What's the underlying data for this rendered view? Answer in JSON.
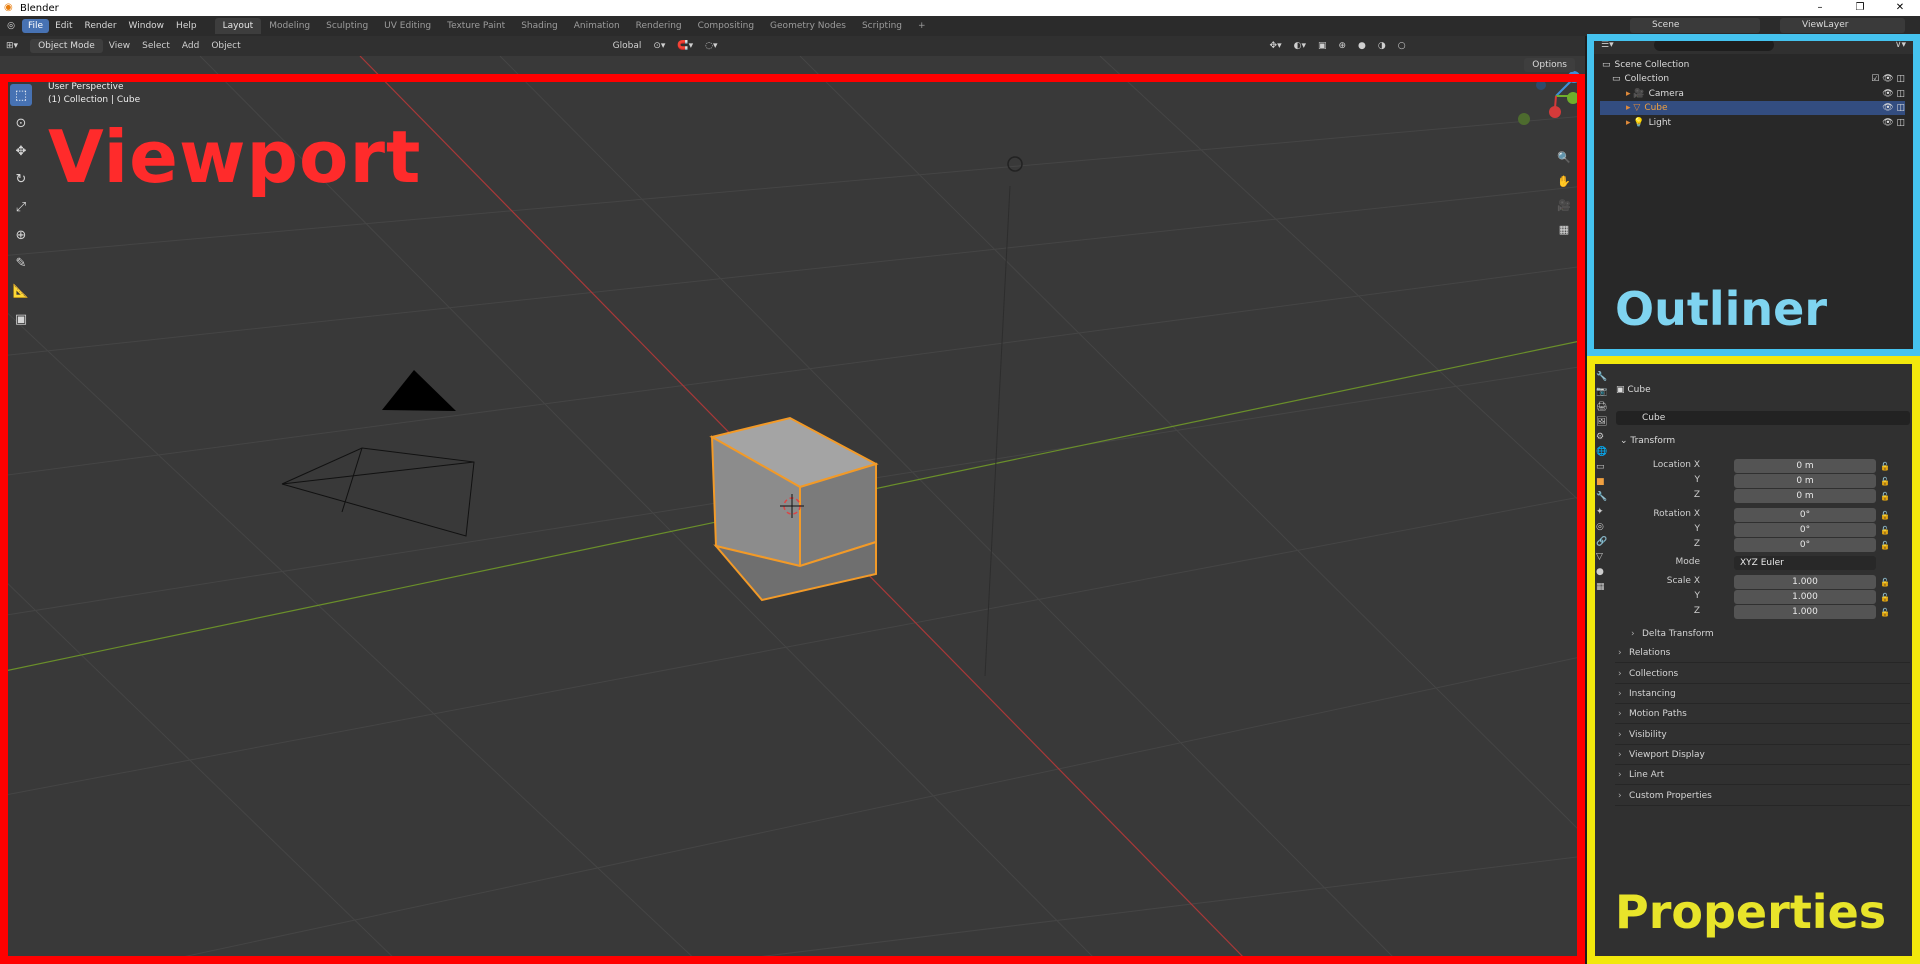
{
  "window": {
    "title": "Blender",
    "controls": [
      "–",
      "❐",
      "✕"
    ]
  },
  "menu": [
    "File",
    "Edit",
    "Render",
    "Window",
    "Help"
  ],
  "workspaces": [
    "Layout",
    "Modeling",
    "Sculpting",
    "UV Editing",
    "Texture Paint",
    "Shading",
    "Animation",
    "Rendering",
    "Compositing",
    "Geometry Nodes",
    "Scripting",
    "+"
  ],
  "scene": {
    "name": "Scene",
    "view_layer": "ViewLayer"
  },
  "viewport": {
    "mode": "Object Mode",
    "menus": [
      "View",
      "Select",
      "Add",
      "Object"
    ],
    "orientation": "Global",
    "options": "Options",
    "perspective": "User Perspective",
    "context": "(1) Collection | Cube",
    "annotation": "Viewport"
  },
  "outliner": {
    "annotation": "Outliner",
    "scene_collection": "Scene Collection",
    "collection": "Collection",
    "items": [
      {
        "label": "Camera"
      },
      {
        "label": "Cube"
      },
      {
        "label": "Light"
      }
    ]
  },
  "properties": {
    "annotation": "Properties",
    "object_name": "Cube",
    "data_name": "Cube",
    "transform_header": "Transform",
    "location": {
      "label": "Location X",
      "x": "0 m",
      "y": "0 m",
      "z": "0 m"
    },
    "rotation": {
      "label": "Rotation X",
      "x": "0°",
      "y": "0°",
      "z": "0°"
    },
    "mode_label": "Mode",
    "mode_value": "XYZ Euler",
    "scale": {
      "label": "Scale X",
      "x": "1.000",
      "y": "1.000",
      "z": "1.000"
    },
    "axis_y": "Y",
    "axis_z": "Z",
    "delta": "Delta Transform",
    "panels": [
      "Relations",
      "Collections",
      "Instancing",
      "Motion Paths",
      "Visibility",
      "Viewport Display",
      "Line Art",
      "Custom Properties"
    ]
  },
  "colors": {
    "accent": "#4772b3",
    "viewport_border": "#ff0000",
    "outliner_border": "#45c3ef",
    "properties_border": "#f2e80c",
    "selection": "#f29a28"
  }
}
